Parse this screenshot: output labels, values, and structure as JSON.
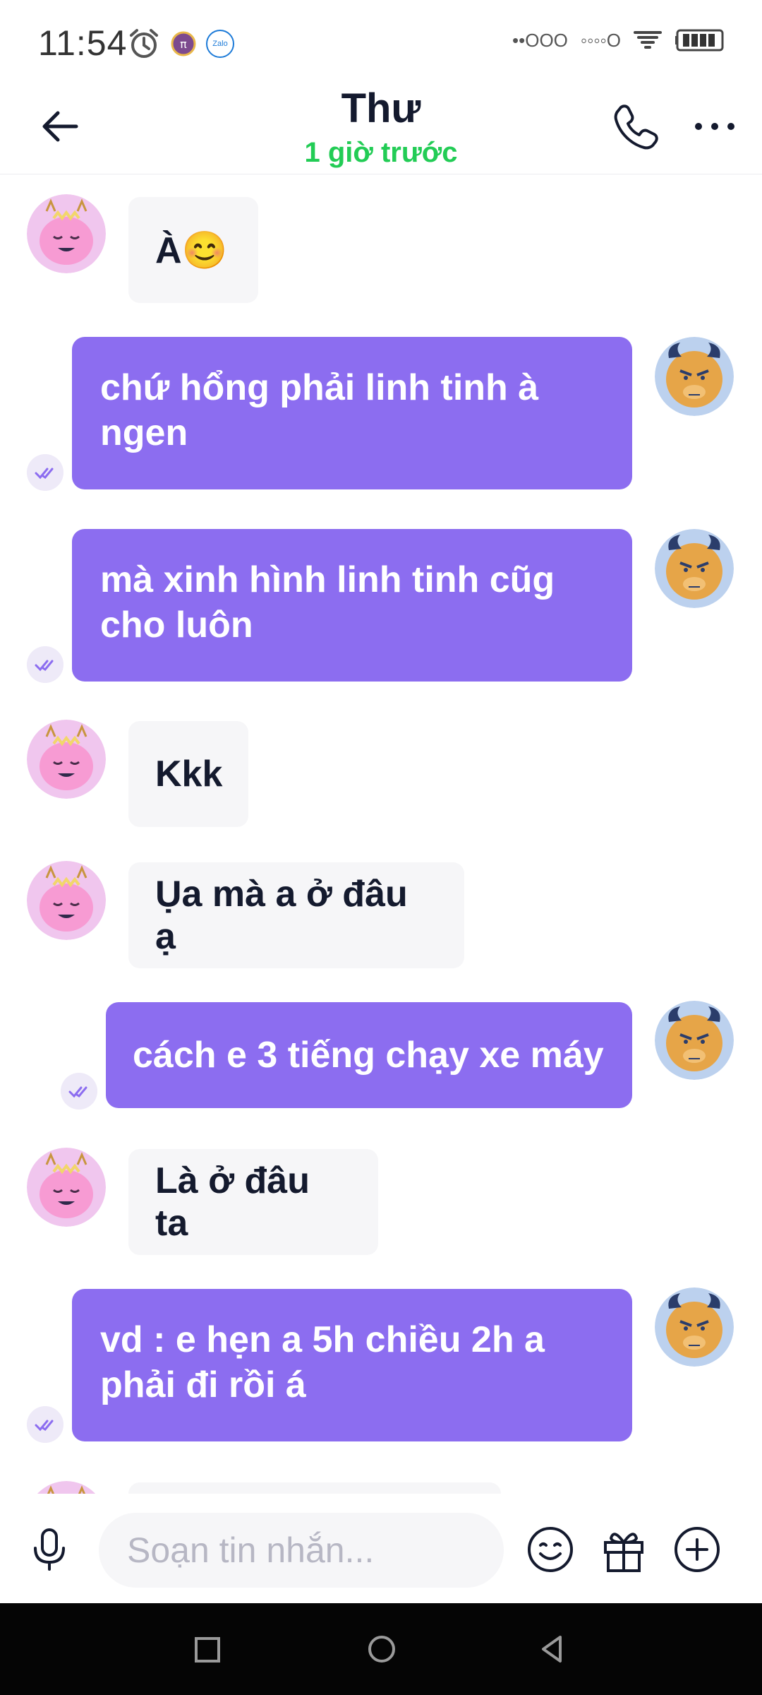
{
  "status_bar": {
    "time": "11:54",
    "app_icons": [
      "alarm-icon",
      "pi-network-icon",
      "zalo-icon"
    ],
    "zalo_label": "Zalo",
    "signal1": "••OOO",
    "signal2": "◦◦◦◦O"
  },
  "header": {
    "name": "Thư",
    "last_seen": "1 giờ trước"
  },
  "messages": [
    {
      "from": "them",
      "text": "À😊"
    },
    {
      "from": "me",
      "text": "chứ hổng phải linh tinh à ngen"
    },
    {
      "from": "me",
      "text": "mà xinh hình linh tinh cũg cho luôn"
    },
    {
      "from": "them",
      "text": "Kkk"
    },
    {
      "from": "them",
      "text": "Ụa mà a ở đâu ạ"
    },
    {
      "from": "me",
      "text": "cách e 3 tiếng chạy xe máy"
    },
    {
      "from": "them",
      "text": "Là ở đâu ta"
    },
    {
      "from": "me",
      "text": "vd : e hẹn a 5h chiều 2h a phải đi rồi á"
    }
  ],
  "composer": {
    "placeholder": "Soạn tin nhắn..."
  },
  "colors": {
    "accent": "#8c6df0",
    "online": "#22cc55",
    "incoming_bubble": "#f6f6f8"
  }
}
